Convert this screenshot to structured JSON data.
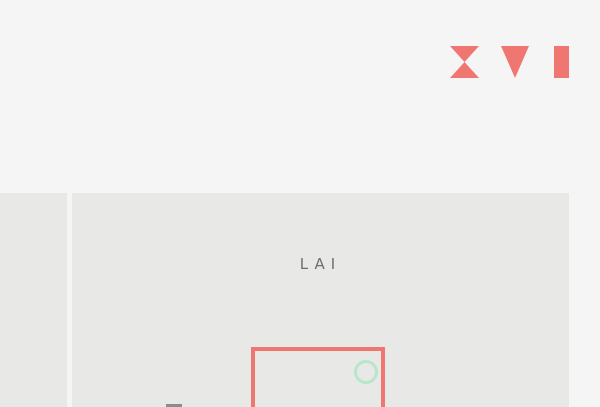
{
  "header": {
    "logo_icon": "xvi-logo-icon",
    "accent_color": "#f07672"
  },
  "level_card": {
    "title": "LAI"
  },
  "colors": {
    "background": "#f5f5f5",
    "card": "#e8e8e7",
    "frame": "#f07672",
    "ring": "#b7e6c9",
    "tile": "#8c8c8c"
  }
}
